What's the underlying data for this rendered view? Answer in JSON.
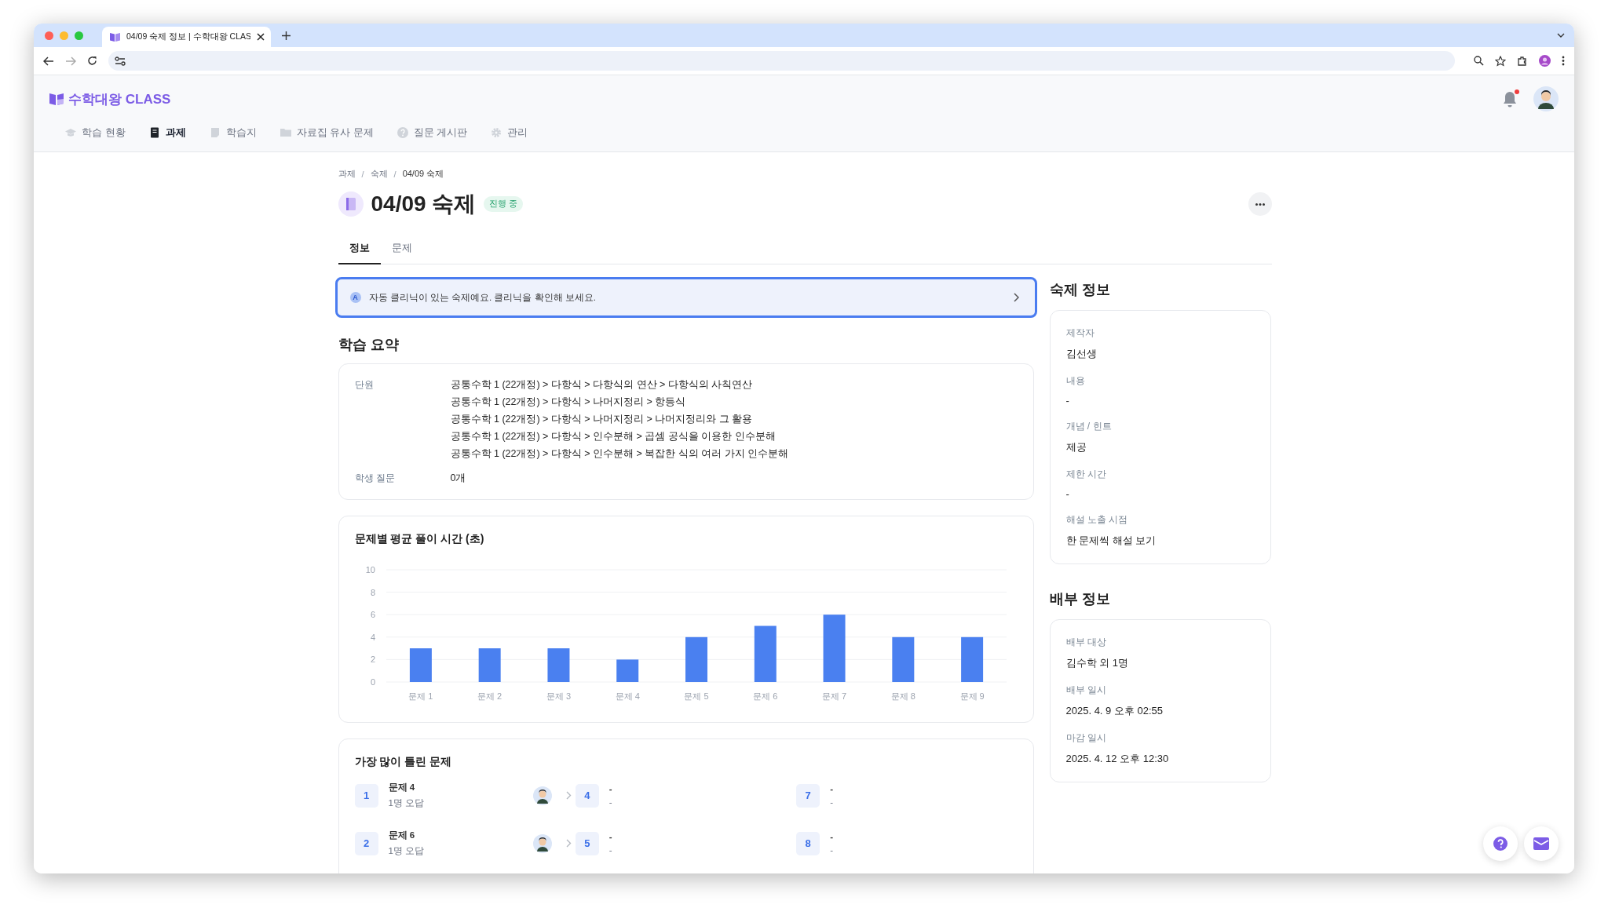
{
  "browser": {
    "tab_title": "04/09 숙제 정보 | 수학대왕 CLAS"
  },
  "header": {
    "logo": "수학대왕 CLASS",
    "has_unread": true,
    "nav": [
      {
        "label": "학습 현황",
        "selected": false
      },
      {
        "label": "과제",
        "selected": true
      },
      {
        "label": "학습지",
        "selected": false
      },
      {
        "label": "자료집 유사 문제",
        "selected": false
      },
      {
        "label": "질문 게시판",
        "selected": false
      },
      {
        "label": "관리",
        "selected": false
      }
    ]
  },
  "breadcrumb": [
    {
      "kind": "link",
      "text": "과제"
    },
    {
      "kind": "sep",
      "text": "/"
    },
    {
      "kind": "link",
      "text": "숙제"
    },
    {
      "kind": "sep",
      "text": "/"
    },
    {
      "kind": "current",
      "text": "04/09 숙제"
    }
  ],
  "title": "04/09 숙제",
  "status": "진행 중",
  "tabs": [
    {
      "label": "정보",
      "selected": true
    },
    {
      "label": "문제",
      "selected": false
    }
  ],
  "banner": {
    "badge": "A",
    "text": "자동 클리닉이 있는 숙제예요. 클리닉을 확인해 보세요.",
    "focused": true
  },
  "summary": {
    "heading": "학습 요약",
    "rows": [
      {
        "label": "단원",
        "values": [
          "공통수학 1 (22개정) > 다항식 > 다항식의 연산 > 다항식의 사칙연산",
          "공통수학 1 (22개정) > 다항식 > 나머지정리 > 항등식",
          "공통수학 1 (22개정) > 다항식 > 나머지정리 > 나머지정리와 그 활용",
          "공통수학 1 (22개정) > 다항식 > 인수분해 > 곱셈 공식을 이용한 인수분해",
          "공통수학 1 (22개정) > 다항식 > 인수분해 > 복잡한 식의 여러 가지 인수분해"
        ]
      },
      {
        "label": "학생 질문",
        "values": [
          "0개"
        ]
      }
    ]
  },
  "time_chart": {
    "chart_data": {
      "type": "bar",
      "title": "문제별 평균 풀이 시간 (초)",
      "categories": [
        "문제 1",
        "문제 2",
        "문제 3",
        "문제 4",
        "문제 5",
        "문제 6",
        "문제 7",
        "문제 8",
        "문제 9"
      ],
      "values": [
        3,
        3,
        3,
        2,
        4,
        5,
        6,
        4,
        4
      ],
      "ylim": [
        0,
        10
      ],
      "yticks": [
        0,
        2,
        4,
        6,
        8,
        10
      ],
      "grid": true
    }
  },
  "most_wrong": {
    "heading": "가장 많이 틀린 문제",
    "rows": [
      {
        "rank": "1",
        "title": "문제 4",
        "detail": "1명 오답",
        "slots": [
          {
            "number": "4",
            "lines": [
              "-",
              "-"
            ]
          },
          {
            "number": "7",
            "lines": [
              "-",
              "-"
            ]
          }
        ]
      },
      {
        "rank": "2",
        "title": "문제 6",
        "detail": "1명 오답",
        "slots": [
          {
            "number": "5",
            "lines": [
              "-",
              "-"
            ]
          },
          {
            "number": "8",
            "lines": [
              "-",
              "-"
            ]
          }
        ]
      }
    ]
  },
  "homework_info": {
    "heading": "숙제 정보",
    "fields": [
      {
        "label": "제작자",
        "value": "김선생"
      },
      {
        "label": "내용",
        "value": "-"
      },
      {
        "label": "개념 / 힌트",
        "value": "제공"
      },
      {
        "label": "제한 시간",
        "value": "-"
      },
      {
        "label": "해설 노출 시점",
        "value": "한 문제씩 해설 보기"
      }
    ]
  },
  "distribution_info": {
    "heading": "배부 정보",
    "fields": [
      {
        "label": "배부 대상",
        "value": "김수학 외 1명"
      },
      {
        "label": "배부 일시",
        "value": "2025. 4. 9 오후 02:55"
      },
      {
        "label": "마감 일시",
        "value": "2025. 4. 12 오후 12:30"
      }
    ]
  }
}
